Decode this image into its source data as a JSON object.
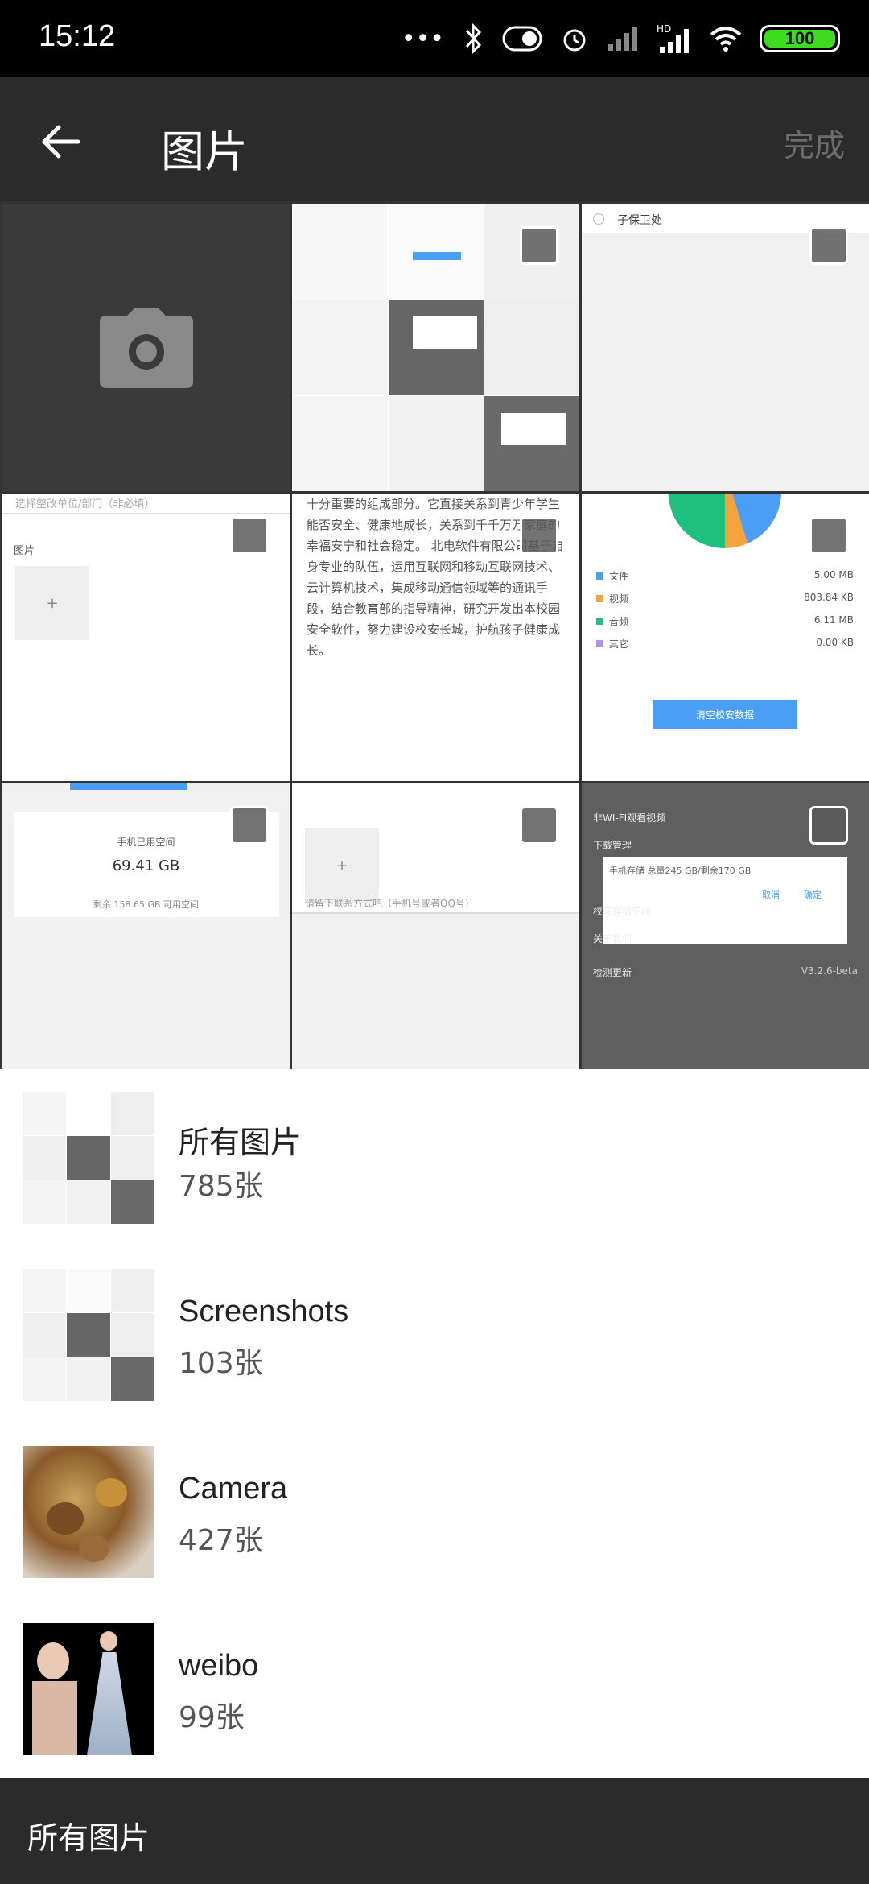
{
  "status": {
    "time": "15:12",
    "battery": "100"
  },
  "toolbar": {
    "title": "图片",
    "done_label": "完成"
  },
  "grid": {
    "cell2_text": "子保卫处",
    "cell3_placeholder": "选择整改单位/部门（非必填）",
    "cell3_label": "图片",
    "cell4_text": "十分重要的组成部分。它直接关系到青少年学生能否安全、健康地成长，关系到千千万万家庭的幸福安宁和社会稳定。 北电软件有限公司基于自身专业的队伍，运用互联网和移动互联网技术、云计算机技术，集成移动通信领域等的通讯手段，结合教育部的指导精神，研究开发出本校园安全软件，努力建设校安长城，护航孩子健康成长。",
    "storage_items": [
      {
        "label": "文件",
        "value": "5.00 MB",
        "color": "#4a9ff5"
      },
      {
        "label": "视频",
        "value": "803.84 KB",
        "color": "#f5a33a"
      },
      {
        "label": "音频",
        "value": "6.11 MB",
        "color": "#1fbf7f"
      },
      {
        "label": "其它",
        "value": "0.00 KB",
        "color": "#b38ef3"
      }
    ],
    "clear_button": "清空校安数据",
    "phone_space_label": "手机已用空间",
    "phone_space_value": "69.41 GB",
    "phone_space_remaining": "剩余 158.65 GB 可用空间",
    "contact_placeholder": "请留下联系方式吧（手机号或者QQ号）",
    "settings": {
      "wifi_video": "非WI-FI观看视频",
      "download": "下载管理",
      "storage_dialog": "手机存储  总量245 GB/剩余170 GB",
      "cancel": "取消",
      "confirm": "确定",
      "school_storage": "校安存储空间",
      "about": "关于我们",
      "check_update": "检测更新",
      "version": "V3.2.6-beta"
    }
  },
  "albums": [
    {
      "name": "所有图片",
      "count": "785张"
    },
    {
      "name": "Screenshots",
      "count": "103张"
    },
    {
      "name": "Camera",
      "count": "427张"
    },
    {
      "name": "weibo",
      "count": "99张"
    }
  ],
  "bottom_bar": {
    "label": "所有图片"
  }
}
